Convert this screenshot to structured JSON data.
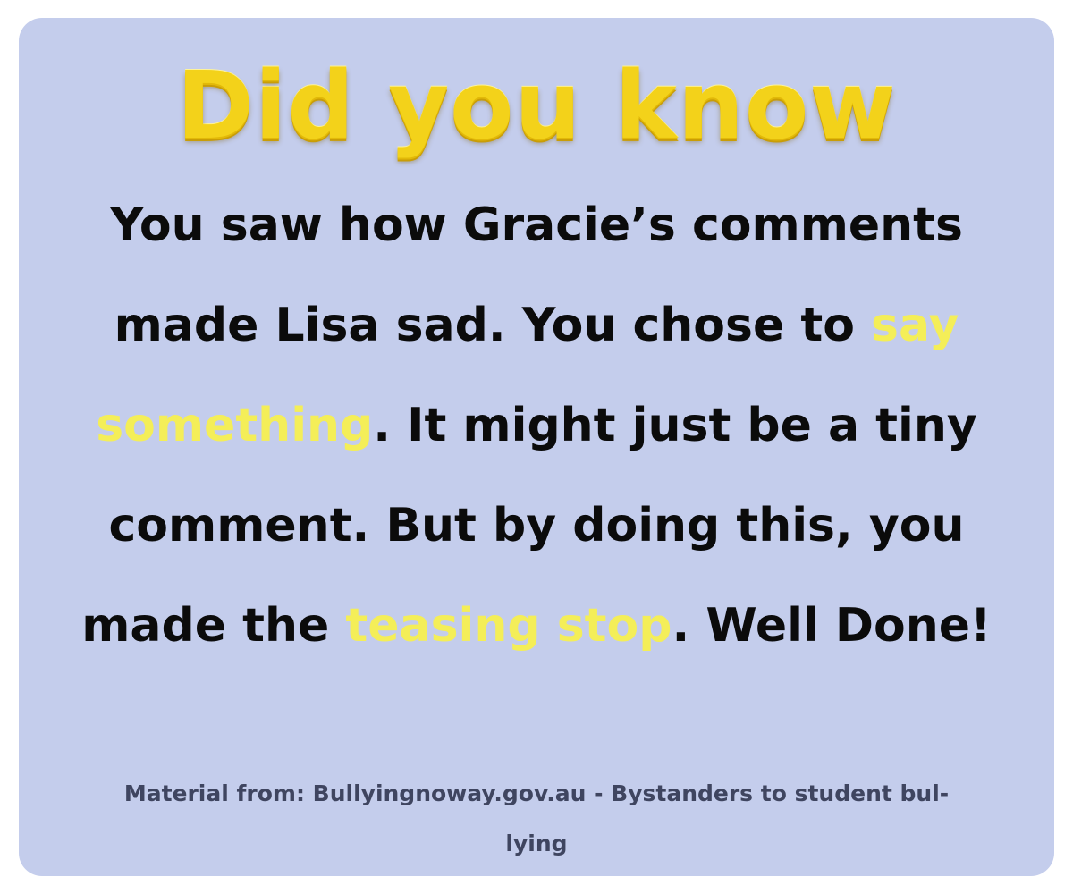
{
  "card": {
    "background_color": "#c4cdec",
    "highlight_color": "#f4ee58",
    "title_color": "#f3d21a"
  },
  "title": "Did you know",
  "message": {
    "part1": "You saw how Gracie’s comments made Lisa sad. You chose to ",
    "highlight1": "say something",
    "part2": ". It might just be a tiny comment. But by doing this, you made the ",
    "highlight2": "teasing stop",
    "part3": ". Well Done!"
  },
  "source": "Material from: Bullyingnoway.gov.au - Bystanders to student bul-lying"
}
